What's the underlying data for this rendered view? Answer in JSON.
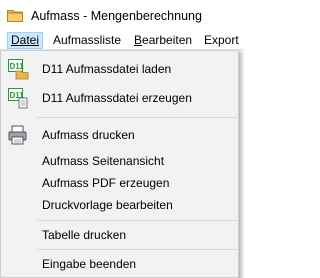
{
  "window": {
    "title": "Aufmass - Mengenberechnung"
  },
  "menubar": {
    "items": [
      {
        "text": "Datei",
        "mnemonic": "D",
        "active": true
      },
      {
        "text": "Aufmassliste"
      },
      {
        "text": "Bearbeiten",
        "mnemonic": "B"
      },
      {
        "text": "Export"
      }
    ]
  },
  "file_menu": {
    "items": [
      {
        "label": "D11 Aufmassdatei laden",
        "icon": "d11-open-icon",
        "icon_text": "D11"
      },
      {
        "label": "D11 Aufmassdatei erzeugen",
        "icon": "d11-create-icon",
        "icon_text": "D11"
      },
      {
        "label": "Aufmass drucken",
        "icon": "printer-icon"
      },
      {
        "label": "Aufmass Seitenansicht"
      },
      {
        "label": "Aufmass PDF erzeugen"
      },
      {
        "label": "Druckvorlage bearbeiten"
      },
      {
        "label": "Tabelle drucken"
      },
      {
        "label": "Eingabe beenden"
      }
    ]
  },
  "colors": {
    "menu_active_bg": "#cce8ff",
    "menu_active_border": "#99d1ff",
    "dropdown_bg": "#f2f2f2",
    "separator": "#d7d7d7",
    "d11_green": "#1f9a3a",
    "folder_yellow": "#e8b94a"
  }
}
